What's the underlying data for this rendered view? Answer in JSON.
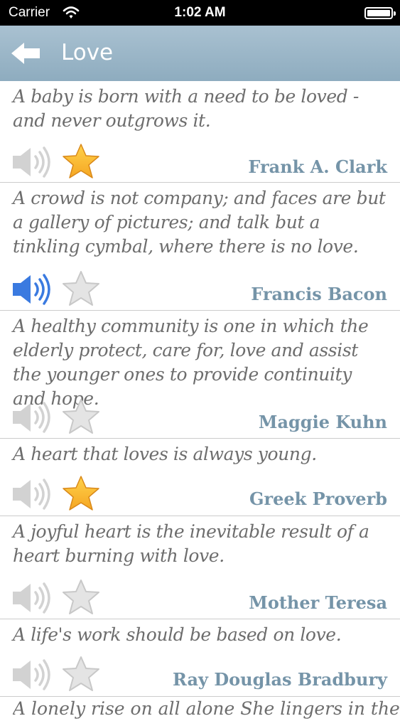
{
  "status_bar": {
    "carrier": "Carrier",
    "time": "1:02 AM"
  },
  "nav": {
    "title": "Love"
  },
  "quotes": [
    {
      "text": "A baby is born with a need to be loved - and never outgrows it.",
      "author": "Frank A. Clark",
      "favorite": true,
      "speaker_active": false
    },
    {
      "text": "A crowd is not company; and faces are but a gallery of pictures; and talk but a tinkling cymbal, where there is no love.",
      "author": "Francis Bacon",
      "favorite": false,
      "speaker_active": true
    },
    {
      "text": "A healthy community is one in which the elderly protect, care for, love and assist the younger ones to provide continuity and hope.",
      "author": "Maggie Kuhn",
      "favorite": false,
      "speaker_active": false
    },
    {
      "text": "A heart that loves is always young.",
      "author": "Greek Proverb",
      "favorite": true,
      "speaker_active": false
    },
    {
      "text": "A joyful heart is the inevitable result of a heart burning with love.",
      "author": "Mother Teresa",
      "favorite": false,
      "speaker_active": false
    },
    {
      "text": "A life's work should be based on love.",
      "author": "Ray Douglas Bradbury",
      "favorite": false,
      "speaker_active": false
    }
  ],
  "partial_quote": "A lonely rise on all alone She lingers in the hill",
  "colors": {
    "nav_bar": "#9bb7c9",
    "author": "#7594a8",
    "quote_text": "#6d6d6d",
    "speaker_active": "#3a7ae0",
    "speaker_inactive": "#d2d2d2",
    "star_favorite": "#f5a623",
    "star_empty": "#e4e4e4"
  }
}
